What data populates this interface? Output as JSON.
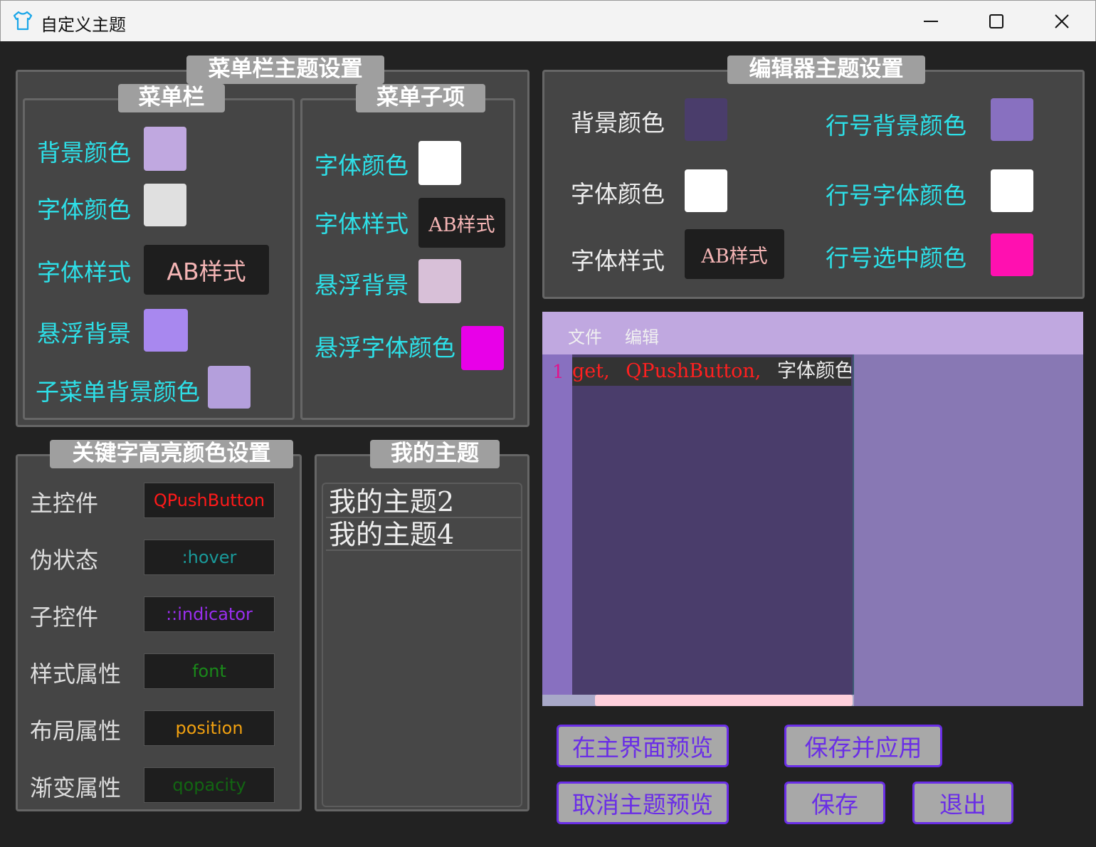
{
  "window": {
    "title": "自定义主题",
    "icons": {
      "app": "shirt-icon",
      "minimize": "minimize-icon",
      "maximize": "maximize-icon",
      "close": "close-icon"
    }
  },
  "menubar_theme": {
    "title": "菜单栏主题设置",
    "menubar": {
      "title": "菜单栏",
      "bg_color_label": "背景颜色",
      "bg_color": "#c0a8e0",
      "font_color_label": "字体颜色",
      "font_color": "#e0e0e0",
      "font_style_label": "字体样式",
      "font_style_value": "AB样式",
      "hover_bg_label": "悬浮背景",
      "hover_bg": "#a888ef",
      "submenu_bg_label": "子菜单背景颜色",
      "submenu_bg": "#b49fdc"
    },
    "menu_item": {
      "title": "菜单子项",
      "font_color_label": "字体颜色",
      "font_color": "#ffffff",
      "font_style_label": "字体样式",
      "font_style_value": "AB样式",
      "hover_bg_label": "悬浮背景",
      "hover_bg": "#d8c0d8",
      "hover_font_color_label": "悬浮字体颜色",
      "hover_font_color": "#e800e8"
    }
  },
  "editor_theme": {
    "title": "编辑器主题设置",
    "bg_color_label": "背景颜色",
    "bg_color": "#4a3d6b",
    "font_color_label": "字体颜色",
    "font_color": "#ffffff",
    "font_style_label": "字体样式",
    "font_style_value": "AB样式",
    "line_bg_label": "行号背景颜色",
    "line_bg": "#8870c0",
    "line_font_label": "行号字体颜色",
    "line_font": "#ffffff",
    "line_sel_label": "行号选中颜色",
    "line_sel": "#ff10b0"
  },
  "keywords": {
    "title": "关键字高亮颜色设置",
    "items": [
      {
        "label": "主控件",
        "value": "QPushButton",
        "color": "#ff1a1a"
      },
      {
        "label": "伪状态",
        "value": ":hover",
        "color": "#1a9a9a"
      },
      {
        "label": "子控件",
        "value": "::indicator",
        "color": "#9a2ef0"
      },
      {
        "label": "样式属性",
        "value": "font",
        "color": "#1a8a1a"
      },
      {
        "label": "布局属性",
        "value": "position",
        "color": "#f0a010"
      },
      {
        "label": "渐变属性",
        "value": "qopacity",
        "color": "#126612"
      }
    ]
  },
  "my_themes": {
    "title": "我的主题",
    "items": [
      "我的主题2",
      "我的主题4"
    ]
  },
  "preview": {
    "menu": [
      "文件",
      "编辑"
    ],
    "line_number": "1",
    "code_red1": "get,",
    "code_red2": "QPushButton,",
    "code_white": "字体颜色"
  },
  "buttons": {
    "preview_main": "在主界面预览",
    "save_apply": "保存并应用",
    "cancel_preview": "取消主题预览",
    "save": "保存",
    "exit": "退出"
  }
}
